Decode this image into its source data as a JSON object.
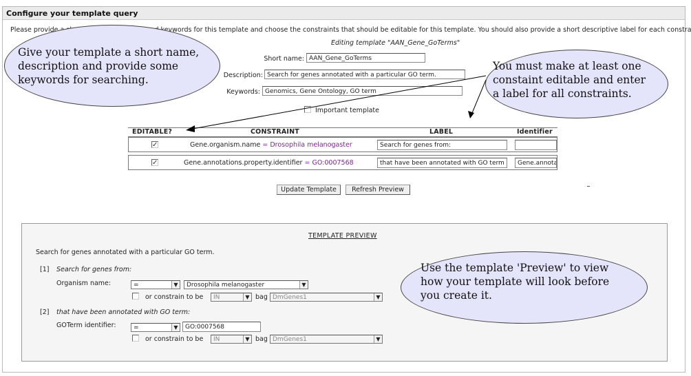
{
  "panel": {
    "title": "Configure your template query"
  },
  "intro": "Please provide a short name, description and keywords for this template and choose the constraints that should be editable for this template. You should also provide a short descriptive label for each constraint.",
  "editing_label": "Editing template \"AAN_Gene_GoTerms\"",
  "form": {
    "short_name_label": "Short name:",
    "short_name_value": "AAN_Gene_GoTerms",
    "description_label": "Description:",
    "description_value": "Search for genes annotated with a particular GO term.",
    "keywords_label": "Keywords:",
    "keywords_value": "Genomics, Gene Ontology, GO term",
    "important_label": "Important template"
  },
  "constraints": {
    "headers": [
      "EDITABLE?",
      "CONSTRAINT",
      "LABEL",
      "Identifier"
    ],
    "rows": [
      {
        "checked": "✓",
        "path": "Gene.organism.name",
        "op": "=",
        "value": "Drosophila melanogaster",
        "label": "Search for genes from:",
        "identifier": ""
      },
      {
        "checked": "✓",
        "path": "Gene.annotations.property.identifier",
        "op": "=",
        "value": "GO:0007568",
        "label": "that have been annotated with GO term",
        "identifier": "Gene.annotations"
      }
    ]
  },
  "buttons": {
    "update": "Update Template",
    "refresh": "Refresh Preview"
  },
  "preview": {
    "title": "TEMPLATE PREVIEW",
    "description": "Search for genes annotated with a particular GO term.",
    "c1_index": "[1]",
    "c1_label": "Search for genes from:",
    "c1_field": "Organism name:",
    "c1_op": "=",
    "c1_value": "Drosophila melanogaster",
    "c1_constrain": "or constrain to be",
    "c1_in": "IN",
    "c1_bag": "bag",
    "c1_bag_value": "DmGenes1",
    "c2_index": "[2]",
    "c2_label": "that have been annotated with GO term:",
    "c2_field": "GOTerm identifier:",
    "c2_op": "=",
    "c2_value": "GO:0007568",
    "c2_constrain": "or constrain to be",
    "c2_in": "IN",
    "c2_bag": "bag",
    "c2_bag_value": "DmGenes1"
  },
  "callouts": {
    "c1": [
      "Give your template a short name,",
      "description and provide some",
      "keywords for searching."
    ],
    "c2": [
      "You must make at least one",
      "constaint editable and enter",
      "a label for all constraints."
    ],
    "c3": [
      "Use the template 'Preview' to view",
      "how your template will look before",
      "you create it."
    ]
  },
  "colors": {
    "bubble_fill": "#e4e4fb",
    "constraint_value": "#7a2a8a",
    "header_bg": "#ebebeb"
  }
}
